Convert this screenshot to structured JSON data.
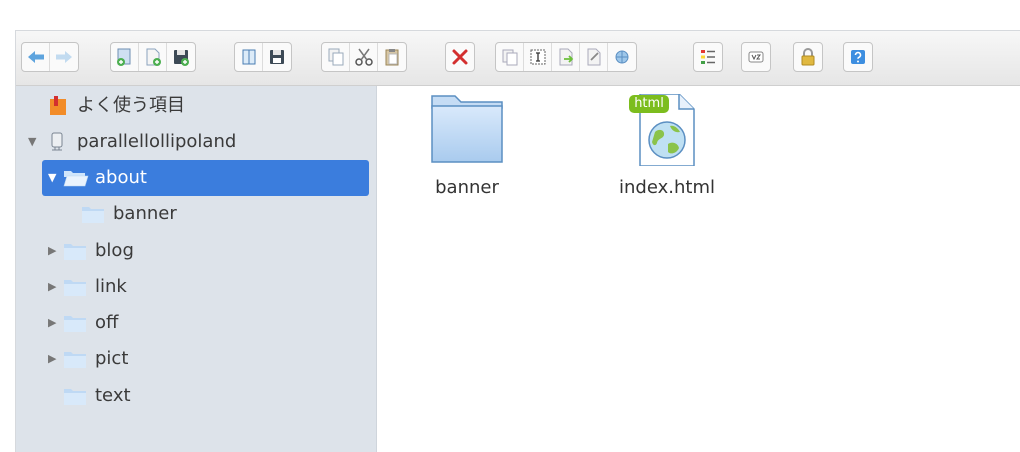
{
  "toolbar": {
    "groups": [
      {
        "buttons": [
          {
            "icon": "back-arrow-icon",
            "enabled": true
          },
          {
            "icon": "forward-arrow-icon",
            "enabled": false
          }
        ]
      },
      {
        "buttons": [
          {
            "icon": "new-folder-icon",
            "enabled": true
          },
          {
            "icon": "new-file-icon",
            "enabled": true
          },
          {
            "icon": "upload-icon",
            "enabled": true
          }
        ]
      },
      {
        "buttons": [
          {
            "icon": "open-icon",
            "enabled": true
          },
          {
            "icon": "download-icon",
            "enabled": true
          }
        ]
      },
      {
        "buttons": [
          {
            "icon": "copy-icon",
            "enabled": true
          },
          {
            "icon": "cut-icon",
            "enabled": true
          },
          {
            "icon": "paste-icon",
            "enabled": true
          }
        ]
      },
      {
        "buttons": [
          {
            "icon": "delete-icon",
            "enabled": true
          }
        ]
      },
      {
        "buttons": [
          {
            "icon": "duplicate-icon",
            "enabled": true
          },
          {
            "icon": "rename-icon",
            "enabled": true
          },
          {
            "icon": "edit-icon",
            "enabled": true
          },
          {
            "icon": "resize-icon",
            "enabled": true
          },
          {
            "icon": "archive-icon",
            "enabled": true
          }
        ]
      },
      {
        "buttons": [
          {
            "icon": "view-list-icon",
            "enabled": true
          }
        ]
      },
      {
        "buttons": [
          {
            "icon": "sort-icon",
            "enabled": true
          }
        ]
      },
      {
        "buttons": [
          {
            "icon": "lock-icon",
            "enabled": true
          }
        ]
      },
      {
        "buttons": [
          {
            "icon": "help-icon",
            "enabled": true
          }
        ]
      }
    ]
  },
  "sidebar": {
    "favorites_label": "よく使う項目",
    "root_label": "parallellollipoland",
    "items": [
      {
        "label": "about",
        "selected": true,
        "expanded": true
      },
      {
        "label": "banner",
        "child": true
      },
      {
        "label": "blog",
        "expandable": true
      },
      {
        "label": "link",
        "expandable": true
      },
      {
        "label": "off",
        "expandable": true
      },
      {
        "label": "pict",
        "expandable": true
      },
      {
        "label": "text",
        "expandable": false
      }
    ]
  },
  "content": {
    "items": [
      {
        "name": "banner",
        "type": "folder"
      },
      {
        "name": "index.html",
        "type": "html",
        "badge": "html"
      }
    ]
  },
  "colors": {
    "selection": "#3b7ddd",
    "sidebar_bg": "#dde3ea",
    "html_badge": "#7cbd1e"
  }
}
